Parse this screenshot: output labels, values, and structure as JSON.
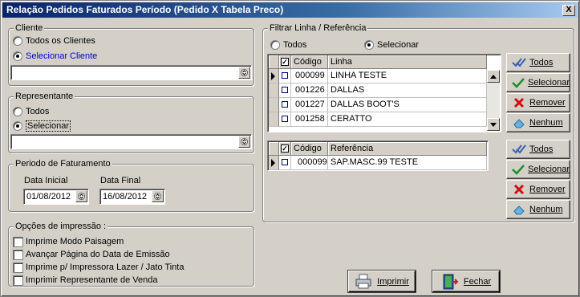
{
  "window": {
    "title": "Relação Pedidos Faturados Período (Pedido X Tabela Preco)",
    "close_label": "X"
  },
  "cliente": {
    "title": "Cliente",
    "option_all": "Todos os Clientes",
    "option_select": "Selecionar Cliente",
    "selected": "select",
    "value": ""
  },
  "representante": {
    "title": "Representante",
    "option_all": "Todos",
    "option_select": "Selecionar",
    "selected": "select",
    "value": ""
  },
  "periodo": {
    "title": "Periodo de Faturamento",
    "start_label": "Data Inicial",
    "start_value": "01/08/2012",
    "end_label": "Data Final",
    "end_value": "16/08/2012"
  },
  "opcoes": {
    "title": "Opções de impressão :",
    "items": [
      {
        "label": "Imprime Modo Paisagem",
        "checked": false
      },
      {
        "label": "Avançar Página do Data de Emissão",
        "checked": false
      },
      {
        "label": "Imprime p/ Impressora Lazer / Jato Tinta",
        "checked": false
      },
      {
        "label": "Imprimir Representante de Venda",
        "checked": false
      }
    ]
  },
  "filtro": {
    "title": "Filtrar Linha / Referência",
    "option_all": "Todos",
    "option_select": "Selecionar",
    "selected": "select",
    "linhas_grid": {
      "columns": [
        "Código",
        "Linha"
      ],
      "rows": [
        {
          "codigo": "000099",
          "nome": "LINHA TESTE",
          "current": true
        },
        {
          "codigo": "001226",
          "nome": "DALLAS",
          "current": false
        },
        {
          "codigo": "001227",
          "nome": "DALLAS BOOT'S",
          "current": false
        },
        {
          "codigo": "001258",
          "nome": "CERATTO",
          "current": false
        }
      ]
    },
    "referencias_grid": {
      "columns": [
        "Código",
        "Referência"
      ],
      "rows": [
        {
          "codigo": "000099",
          "nome": "SAP.MASC.99 TESTE",
          "current": true
        }
      ]
    }
  },
  "side_buttons": {
    "todos": "Todos",
    "selecionar": "Selecionar",
    "remover": "Remover",
    "nenhum": "Nenhum"
  },
  "footer": {
    "imprimir": "Imprimir",
    "fechar": "Fechar"
  },
  "colors": {
    "title_start": "#0a246a",
    "title_end": "#a6caf0",
    "face": "#d4d0c8",
    "link_blue": "#0000cc"
  }
}
